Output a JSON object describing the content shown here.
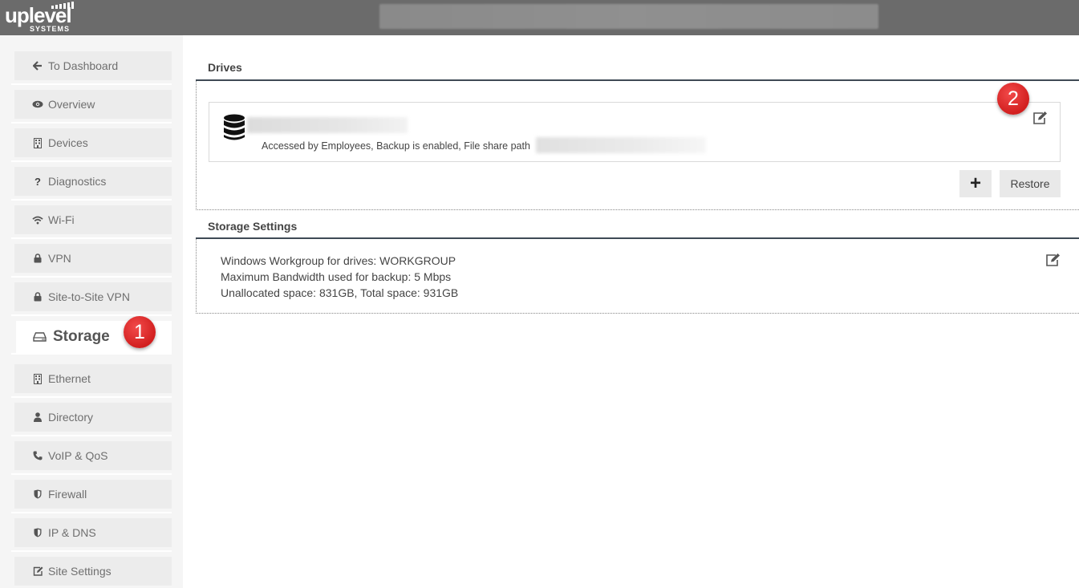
{
  "brand": {
    "word": "uplevel",
    "sub": "SYSTEMS"
  },
  "sidebar": {
    "items": [
      {
        "label": "To Dashboard",
        "icon": "arrow-left-icon"
      },
      {
        "label": "Overview",
        "icon": "eye-icon"
      },
      {
        "label": "Devices",
        "icon": "building-icon"
      },
      {
        "label": "Diagnostics",
        "icon": "question-icon"
      },
      {
        "label": "Wi-Fi",
        "icon": "wifi-icon"
      },
      {
        "label": "VPN",
        "icon": "lock-icon"
      },
      {
        "label": "Site-to-Site VPN",
        "icon": "lock-icon"
      },
      {
        "label": "Storage",
        "icon": "hdd-icon",
        "active": true
      },
      {
        "label": "Ethernet",
        "icon": "building-icon"
      },
      {
        "label": "Directory",
        "icon": "user-icon"
      },
      {
        "label": "VoIP & QoS",
        "icon": "phone-icon"
      },
      {
        "label": "Firewall",
        "icon": "shield-icon"
      },
      {
        "label": "IP & DNS",
        "icon": "shield-icon"
      },
      {
        "label": "Site Settings",
        "icon": "edit-icon"
      }
    ]
  },
  "badges": {
    "one": "1",
    "two": "2"
  },
  "drives": {
    "title": "Drives",
    "drive": {
      "icon": "database-icon",
      "description": "Accessed by Employees, Backup is enabled, File share path"
    },
    "add_label": "+",
    "restore_label": "Restore"
  },
  "storage_settings": {
    "title": "Storage Settings",
    "lines": [
      "Windows Workgroup for drives: WORKGROUP",
      "Maximum Bandwidth used for backup: 5 Mbps",
      "Unallocated space: 831GB, Total space: 931GB"
    ]
  },
  "colors": {
    "topbar": "#6b6b6b",
    "badge": "#d9262b",
    "section_line": "#3f4a55"
  }
}
